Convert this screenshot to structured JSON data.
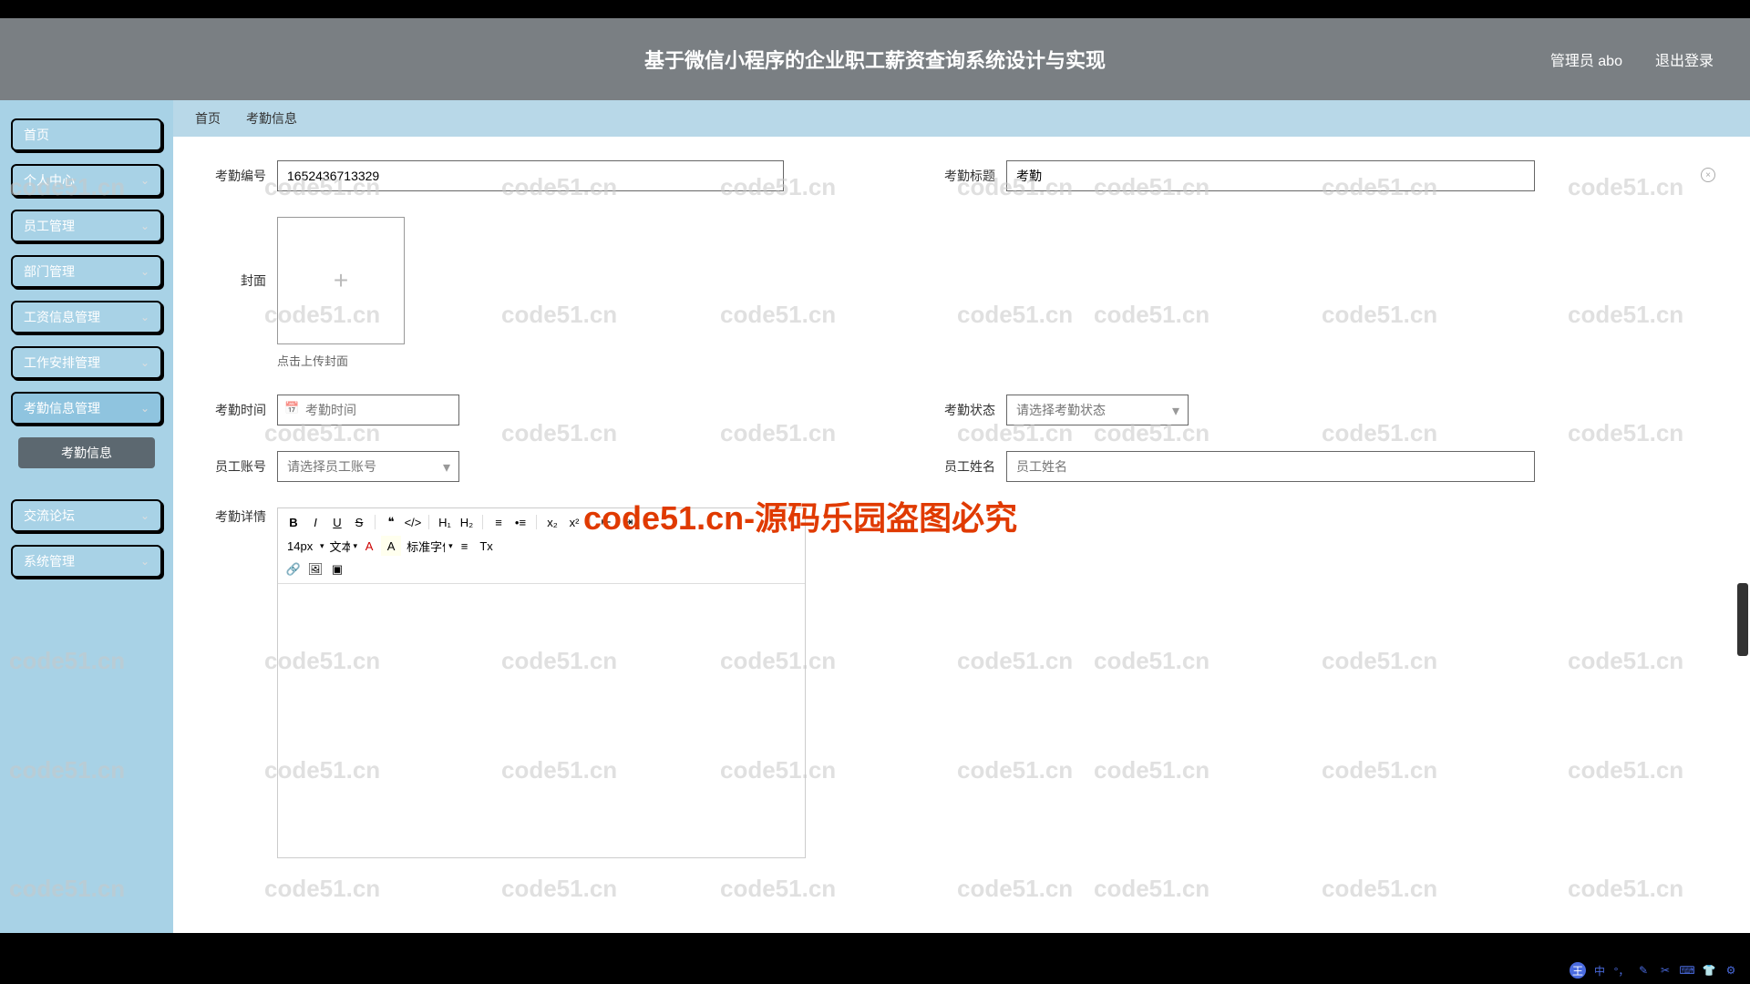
{
  "header": {
    "title": "基于微信小程序的企业职工薪资查询系统设计与实现",
    "admin": "管理员 abo",
    "logout": "退出登录"
  },
  "sidebar": {
    "items": [
      {
        "label": "首页",
        "chev": false
      },
      {
        "label": "个人中心",
        "chev": true
      },
      {
        "label": "员工管理",
        "chev": true
      },
      {
        "label": "部门管理",
        "chev": true
      },
      {
        "label": "工资信息管理",
        "chev": true
      },
      {
        "label": "工作安排管理",
        "chev": true
      },
      {
        "label": "考勤信息管理",
        "chev": true,
        "active": true
      }
    ],
    "sub_item": "考勤信息",
    "items2": [
      {
        "label": "交流论坛",
        "chev": true
      },
      {
        "label": "系统管理",
        "chev": true
      }
    ]
  },
  "crumbs": {
    "home": "首页",
    "current": "考勤信息"
  },
  "form": {
    "id_label": "考勤编号",
    "id_value": "1652436713329",
    "title_label": "考勤标题",
    "title_value": "考勤",
    "cover_label": "封面",
    "cover_hint": "点击上传封面",
    "time_label": "考勤时间",
    "time_placeholder": "考勤时间",
    "status_label": "考勤状态",
    "status_placeholder": "请选择考勤状态",
    "account_label": "员工账号",
    "account_placeholder": "请选择员工账号",
    "name_label": "员工姓名",
    "name_placeholder": "员工姓名",
    "detail_label": "考勤详情"
  },
  "editor": {
    "font_size": "14px",
    "block": "文本",
    "font_family": "标准字体",
    "btns": {
      "bold": "B",
      "italic": "I",
      "underline": "U",
      "strike": "S",
      "quote": "❝",
      "code": "</>",
      "h1": "H₁",
      "h2": "H₂",
      "ol": "≡",
      "ul": "•≡",
      "sub": "x₂",
      "sup": "x²",
      "outdent": "⇤",
      "indent": "⇥",
      "color": "A",
      "bg": "A",
      "align": "≡",
      "clear": "Tx",
      "link": "🔗",
      "image": "🖼",
      "video": "▣"
    }
  },
  "center_wm": "code51.cn-源码乐园盗图必究",
  "wm_text": "code51.cn",
  "ime": {
    "brand": "王",
    "lang": "中"
  }
}
